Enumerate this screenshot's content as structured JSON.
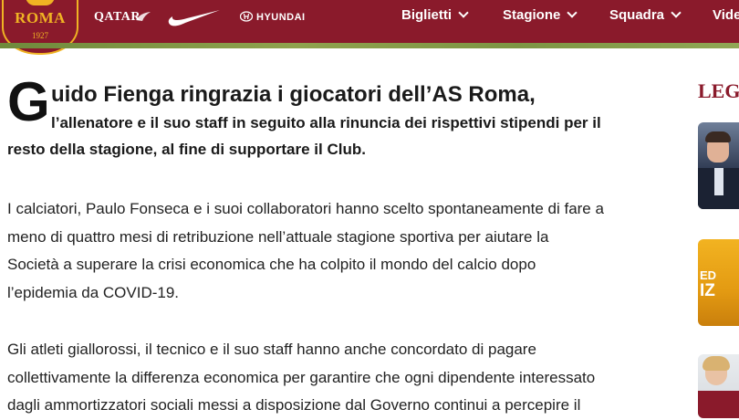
{
  "header": {
    "crest": {
      "name": "ROMA",
      "year": "1927"
    },
    "sponsors": {
      "qatar": "QATAR",
      "hyundai": "HYUNDAI"
    },
    "nav": [
      {
        "label": "Biglietti"
      },
      {
        "label": "Stagione"
      },
      {
        "label": "Squadra"
      },
      {
        "label": "Vide"
      }
    ],
    "colors": {
      "brand": "#8a1a2b",
      "gold": "#f0b323"
    },
    "icons": {
      "nike": "nike-swoosh-logo",
      "dropdown": "chevron-down-icon"
    }
  },
  "article": {
    "dropcap": "G",
    "title": "uido Fienga ringrazia i giocatori dell’AS Roma,",
    "subtitle_lines": [
      "l’allenatore e il suo staff in seguito alla rinuncia dei rispettivi stipendi per il",
      "resto della stagione, al fine di supportare il Club."
    ],
    "paragraphs": [
      [
        "I calciatori, Paulo Fonseca e i suoi collaboratori hanno scelto spontaneamente di fare a",
        "meno di quattro mesi di retribuzione nell’attuale stagione sportiva per aiutare la",
        "Società a superare la crisi economica che ha colpito il mondo del calcio dopo",
        "l’epidemia da COVID-19."
      ],
      [
        "Gli atleti giallorossi, il tecnico e il suo staff hanno anche concordato di pagare",
        "collettivamente la differenza economica per garantire che ogni dipendente interessato",
        "dagli ammortizzatori sociali messi a disposizione dal Governo continui a percepire il"
      ]
    ]
  },
  "sidebar": {
    "title": "LEG",
    "card2_text": [
      "ED",
      "IZ"
    ]
  }
}
